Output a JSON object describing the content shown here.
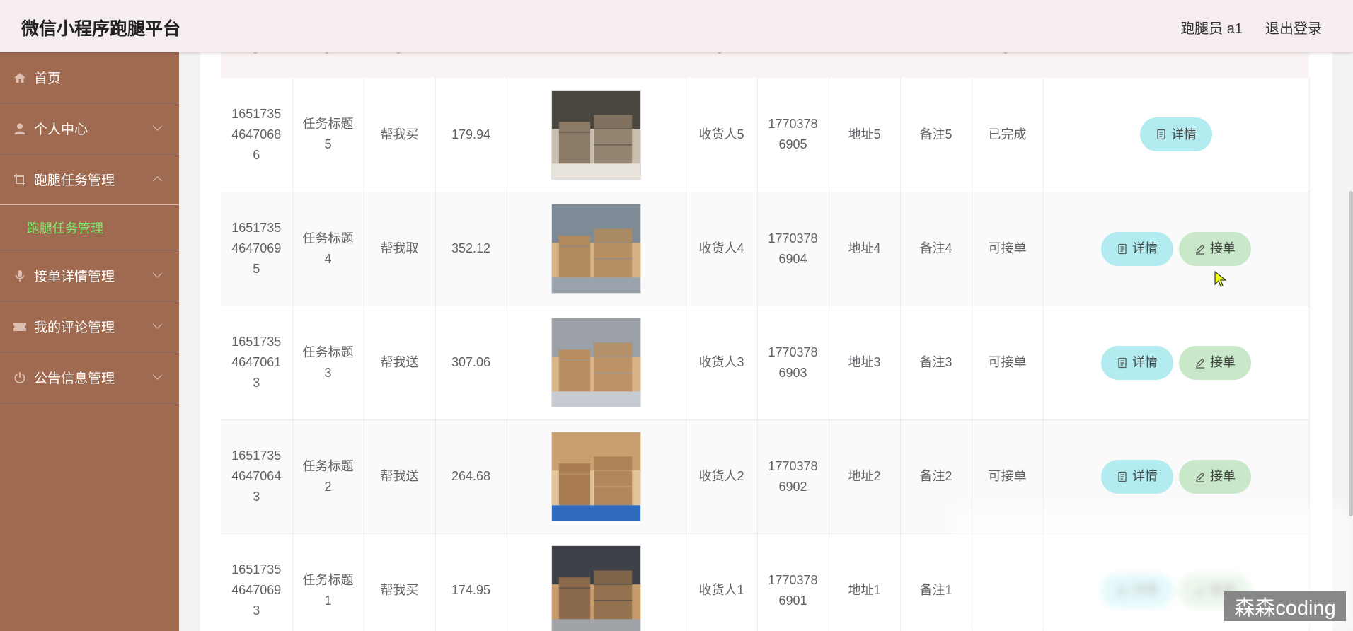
{
  "app": {
    "title": "微信小程序跑腿平台"
  },
  "header": {
    "user_label": "跑腿员 a1",
    "logout_label": "退出登录"
  },
  "sidebar": {
    "items": [
      {
        "label": "首页",
        "icon": "home-icon"
      },
      {
        "label": "个人中心",
        "icon": "user-icon"
      },
      {
        "label": "跑腿任务管理",
        "icon": "crop-icon",
        "expanded": true
      },
      {
        "label": "接单详情管理",
        "icon": "microphone-icon"
      },
      {
        "label": "我的评论管理",
        "icon": "ticket-icon"
      },
      {
        "label": "公告信息管理",
        "icon": "power-icon"
      }
    ],
    "active_sub": "跑腿任务管理"
  },
  "table": {
    "rows": [
      {
        "id": "16517354647068 6",
        "id_lines": [
          "1651735",
          "4647068",
          "6"
        ],
        "title_lines": [
          "任务标题",
          "5"
        ],
        "type": "帮我买",
        "price": "179.94",
        "image": "warehouse-aisle-image",
        "receiver": "收货人5",
        "phone_lines": [
          "1770378",
          "6905"
        ],
        "address": "地址5",
        "note": "备注5",
        "status": "已完成",
        "actions": [
          "详情"
        ]
      },
      {
        "id": "16517354647069 5",
        "id_lines": [
          "1651735",
          "4647069",
          "5"
        ],
        "title_lines": [
          "任务标题",
          "4"
        ],
        "type": "帮我取",
        "price": "352.12",
        "image": "pallet-boxes-image",
        "receiver": "收货人4",
        "phone_lines": [
          "1770378",
          "6904"
        ],
        "address": "地址4",
        "note": "备注4",
        "status": "可接单",
        "actions": [
          "详情",
          "接单"
        ]
      },
      {
        "id": "16517354647061 3",
        "id_lines": [
          "1651735",
          "4647061",
          "3"
        ],
        "title_lines": [
          "任务标题",
          "3"
        ],
        "type": "帮我送",
        "price": "307.06",
        "image": "stacked-cartons-image",
        "receiver": "收货人3",
        "phone_lines": [
          "1770378",
          "6903"
        ],
        "address": "地址3",
        "note": "备注3",
        "status": "可接单",
        "actions": [
          "详情",
          "接单"
        ]
      },
      {
        "id": "16517354647064 3",
        "id_lines": [
          "1651735",
          "4647064",
          "3"
        ],
        "title_lines": [
          "任务标题",
          "2"
        ],
        "type": "帮我送",
        "price": "264.68",
        "image": "carton-pile-image",
        "receiver": "收货人2",
        "phone_lines": [
          "1770378",
          "6902"
        ],
        "address": "地址2",
        "note": "备注2",
        "status": "可接单",
        "actions": [
          "详情",
          "接单"
        ]
      },
      {
        "id": "16517354647069 3",
        "id_lines": [
          "1651735",
          "4647069",
          "3"
        ],
        "title_lines": [
          "任务标题",
          "1"
        ],
        "type": "帮我买",
        "price": "174.95",
        "image": "loading-dock-image",
        "receiver": "收货人1",
        "phone_lines": [
          "1770378",
          "6901"
        ],
        "address": "地址1",
        "note": "备注1",
        "status": "",
        "actions": [
          "详情",
          "接单"
        ]
      }
    ]
  },
  "watermark": "森森coding",
  "colors": {
    "sidebar_bg": "#a06a50",
    "active_sub": "#7dea6a",
    "detail_btn": "#b3ecf0",
    "accept_btn": "#c9e8c9",
    "topbar_bg": "#f6eeee"
  }
}
